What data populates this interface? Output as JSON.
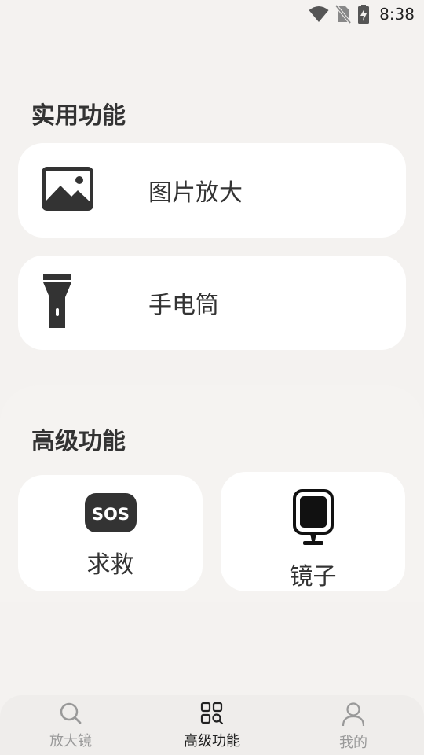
{
  "status_bar": {
    "time": "8:38",
    "icons": [
      "wifi-icon",
      "no-sim-icon",
      "battery-charging-icon"
    ]
  },
  "section_practical": {
    "title": "实用功能",
    "items": [
      {
        "label": "图片放大",
        "icon": "image-icon"
      },
      {
        "label": "手电筒",
        "icon": "flashlight-icon"
      }
    ]
  },
  "section_advanced": {
    "title": "高级功能",
    "items": [
      {
        "label": "求救",
        "icon": "sos-icon",
        "icon_text": "SOS"
      },
      {
        "label": "镜子",
        "icon": "mirror-icon"
      }
    ]
  },
  "bottom_nav": {
    "items": [
      {
        "label": "放大镜",
        "icon": "search-icon",
        "active": false
      },
      {
        "label": "高级功能",
        "icon": "grid-search-icon",
        "active": true
      },
      {
        "label": "我的",
        "icon": "user-icon",
        "active": false
      }
    ]
  },
  "colors": {
    "background": "#f4f2f0",
    "card": "#ffffff",
    "icon_dark": "#333333",
    "nav_inactive": "#999999",
    "nav_active": "#222222"
  }
}
